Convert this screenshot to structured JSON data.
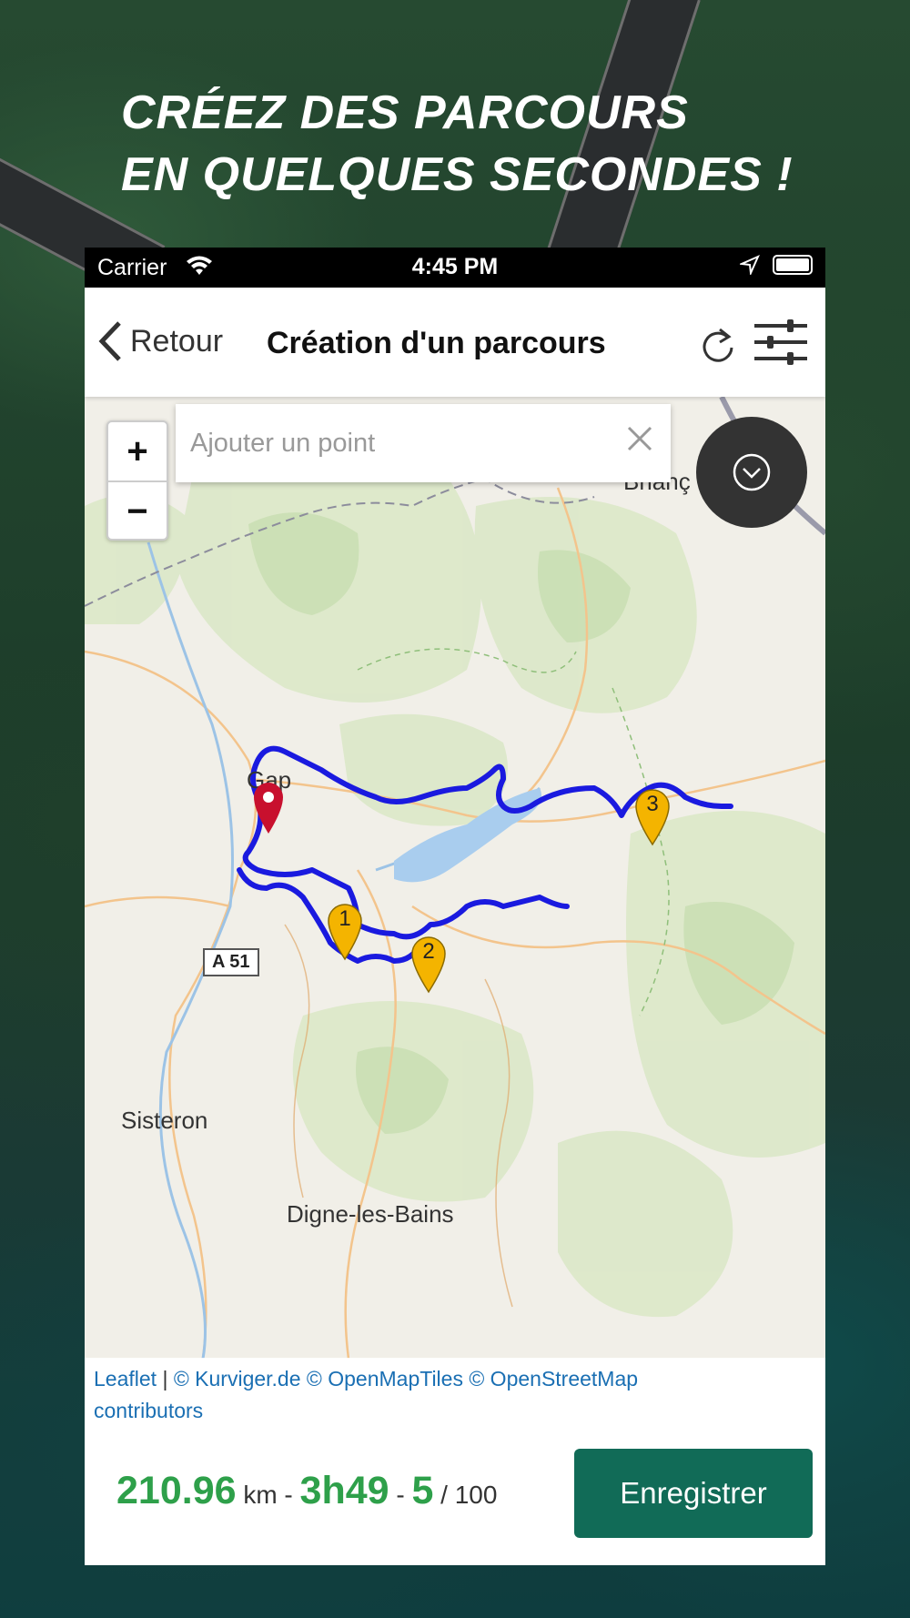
{
  "headline": {
    "line1": "CRÉEZ DES PARCOURS",
    "line2": "EN QUELQUES SECONDES !"
  },
  "status_bar": {
    "carrier": "Carrier",
    "time": "4:45 PM"
  },
  "nav": {
    "back_label": "Retour",
    "title": "Création d'un parcours"
  },
  "map": {
    "search_placeholder": "Ajouter un point",
    "zoom_in": "+",
    "zoom_out": "−",
    "labels": {
      "brianccon": "Brianç",
      "gap": "Gap",
      "sisteron": "Sisteron",
      "digne": "Digne-les-Bains",
      "road": "A 51"
    },
    "waypoints": [
      "1",
      "2",
      "3"
    ],
    "attribution": {
      "leaflet": "Leaflet",
      "sep": " | ",
      "sources": "© Kurviger.de © OpenMapTiles © OpenStreetMap",
      "contributors": "contributors"
    },
    "route_color": "#1a1adf",
    "waypoint_color": "#f4b400",
    "start_marker_color": "#c8102e"
  },
  "summary": {
    "distance": "210.96",
    "distance_unit": "km",
    "sep1": " - ",
    "duration": "3h49",
    "sep2": " - ",
    "points": "5",
    "points_max": "/ 100"
  },
  "actions": {
    "save_label": "Enregistrer"
  },
  "colors": {
    "accent_green": "#2ea04a",
    "button_green": "#116b57"
  }
}
